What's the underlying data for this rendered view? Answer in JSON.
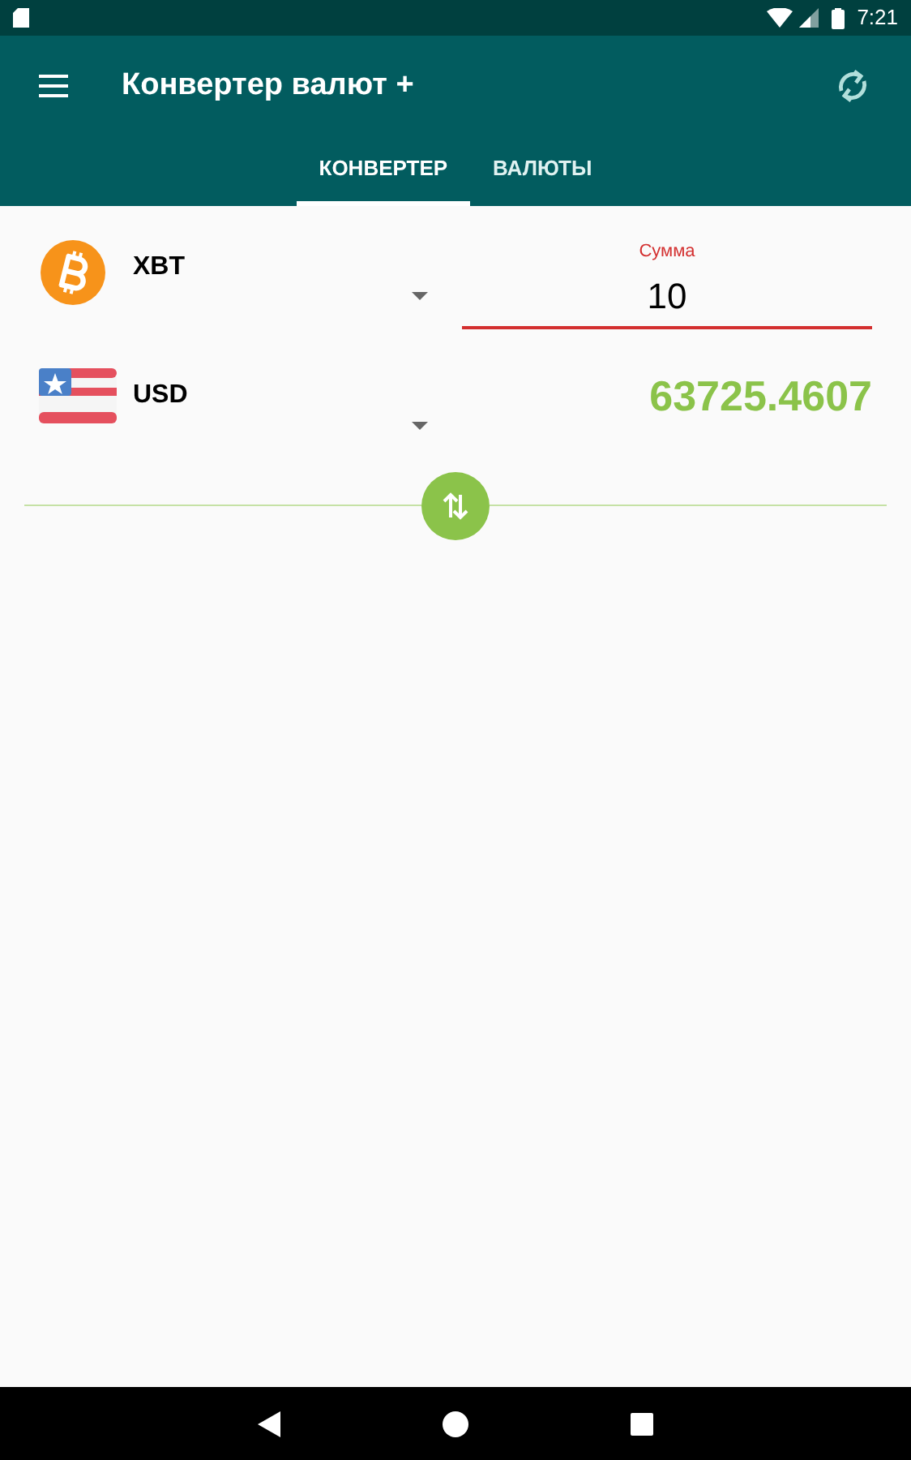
{
  "status_bar": {
    "time": "7:21"
  },
  "app_bar": {
    "title": "Конвертер валют +"
  },
  "tabs": [
    {
      "label": "КОНВЕРТЕР",
      "selected": true
    },
    {
      "label": "ВАЛЮТЫ",
      "selected": false
    }
  ],
  "from": {
    "code": "XBT",
    "kind": "bitcoin",
    "amount_label": "Сумма",
    "amount": "10"
  },
  "to": {
    "code": "USD",
    "kind": "us-flag",
    "result": "63725.4607"
  }
}
